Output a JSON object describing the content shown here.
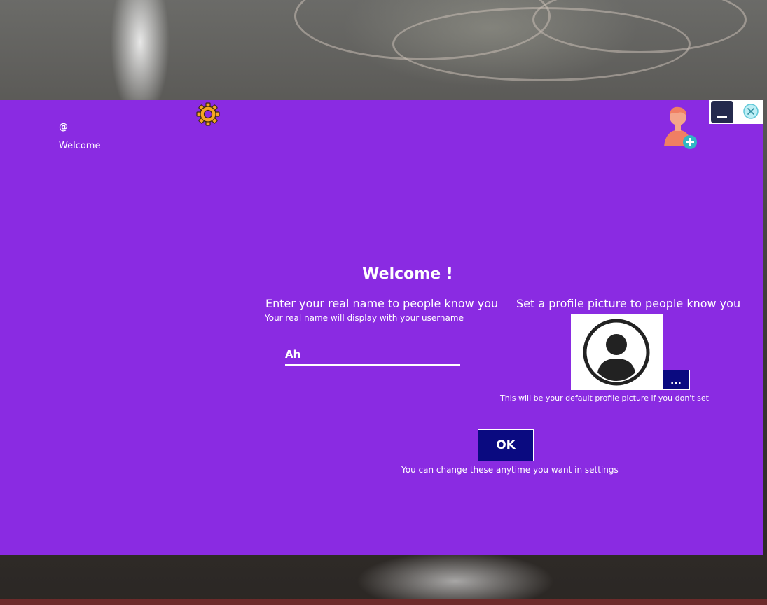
{
  "header": {
    "at_symbol": "@",
    "welcome_label": "Welcome"
  },
  "dialog": {
    "title": "Welcome !",
    "name_section": {
      "heading": "Enter your real name to people know you",
      "subtext": "Your real name will display with your username",
      "input_value": "Ah"
    },
    "picture_section": {
      "heading": "Set a profile picture to people know you",
      "browse_label": "...",
      "note": "This will be your default profile picture if you don't set"
    },
    "ok_label": "OK",
    "settings_note": "You can change these anytime you want in settings"
  },
  "icons": {
    "settings": "gear-icon",
    "add_user": "add-user-icon",
    "minimize": "minimize-icon",
    "close": "close-icon",
    "avatar": "avatar-placeholder-icon"
  },
  "colors": {
    "window_background": "#8a2be2",
    "button_background": "#0a0a80",
    "text": "#ffffff",
    "gear": "#f5a623",
    "close_accent": "#5ec8d8"
  }
}
